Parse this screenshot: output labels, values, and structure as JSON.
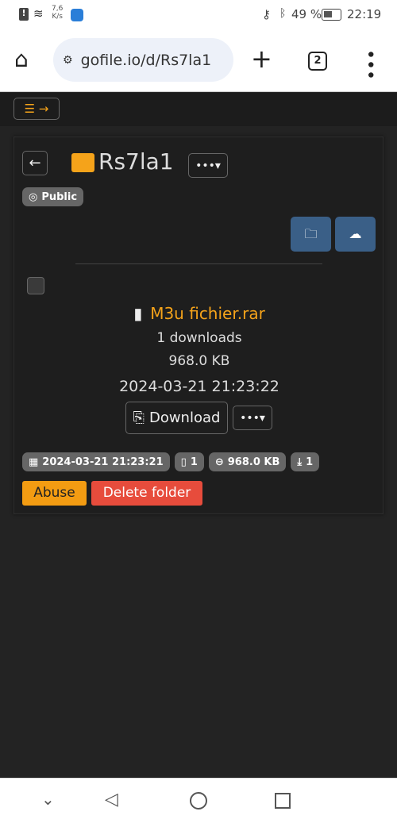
{
  "status_bar": {
    "net_speed_value": "7,6",
    "net_speed_unit": "K/s",
    "battery": "49 %",
    "time": "22:19"
  },
  "browser": {
    "url": "gofile.io/d/Rs7la1",
    "tab_count": "2"
  },
  "folder": {
    "name": "Rs7la1",
    "visibility": "Public"
  },
  "file": {
    "name": "M3u fichier.rar",
    "downloads": "1 downloads",
    "size": "968.0 KB",
    "date": "2024-03-21 21:23:22",
    "download_label": "Download"
  },
  "stats": {
    "created": "2024-03-21 21:23:21",
    "files": "1",
    "size": "968.0 KB",
    "downloads": "1"
  },
  "actions": {
    "abuse": "Abuse",
    "delete": "Delete folder"
  },
  "colors": {
    "accent": "#f5a31a",
    "primary": "#3a5f87",
    "abuse": "#f39c12",
    "danger": "#e74c3c"
  }
}
